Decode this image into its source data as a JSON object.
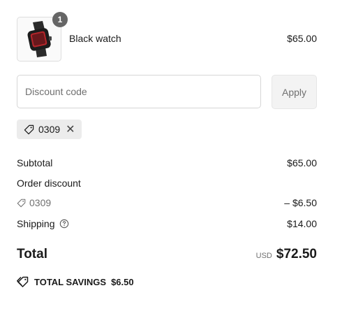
{
  "cart": {
    "item": {
      "name": "Black watch",
      "price": "$65.00",
      "quantity": "1"
    }
  },
  "discount": {
    "placeholder": "Discount code",
    "apply_label": "Apply",
    "applied_code": "0309"
  },
  "summary": {
    "subtotal_label": "Subtotal",
    "subtotal_value": "$65.00",
    "order_discount_label": "Order discount",
    "order_discount_code": "0309",
    "order_discount_value": "– $6.50",
    "shipping_label": "Shipping",
    "shipping_value": "$14.00",
    "total_label": "Total",
    "currency": "USD",
    "total_value": "$72.50",
    "savings_label": "TOTAL SAVINGS",
    "savings_value": "$6.50"
  },
  "icons": {
    "tag": "tag-icon",
    "close": "close-icon",
    "help": "help-circle-icon",
    "savings": "tags-icon"
  }
}
